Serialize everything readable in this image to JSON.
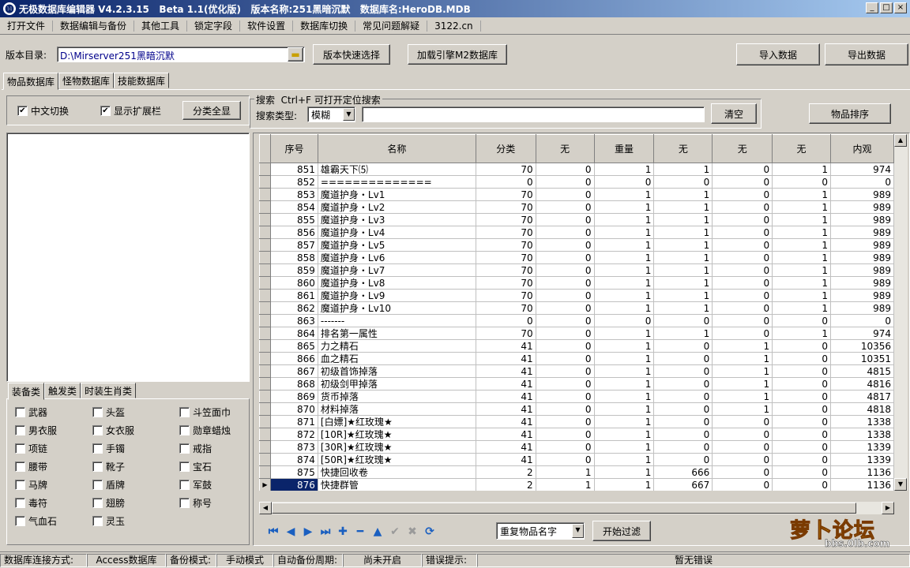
{
  "window": {
    "title": "无极数据库编辑器 V4.2.3.15   Beta 1.1(优化版)   版本名称:251黑暗沉默   数据库名:HeroDB.MDB",
    "min": "_",
    "max": "□",
    "close": "×"
  },
  "menu": [
    "打开文件",
    "数据编辑与备份",
    "其他工具",
    "锁定字段",
    "软件设置",
    "数据库切换",
    "常见问题解疑",
    "3122.cn"
  ],
  "toolbar": {
    "dir_label": "版本目录:",
    "dir_value": "D:\\Mirserver251黑暗沉默",
    "folder_icon": "folder-icon",
    "quick_select": "版本快速选择",
    "load_m2": "加载引擎M2数据库",
    "import": "导入数据",
    "export": "导出数据"
  },
  "tabs": [
    "物品数据库",
    "怪物数据库",
    "技能数据库"
  ],
  "left": {
    "cn_switch": "中文切换",
    "show_ext": "显示扩展栏",
    "show_all": "分类全显",
    "subtabs": [
      "装备类",
      "触发类",
      "时装生肖类"
    ],
    "categories": [
      [
        "武器",
        "头盔",
        "斗笠面巾"
      ],
      [
        "男衣服",
        "女衣服",
        "勋章蜡烛"
      ],
      [
        "项链",
        "手镯",
        "戒指"
      ],
      [
        "腰带",
        "靴子",
        "宝石"
      ],
      [
        "马牌",
        "盾牌",
        "军鼓"
      ],
      [
        "毒符",
        "翅膀",
        "称号"
      ],
      [
        "气血石",
        "灵玉",
        ""
      ]
    ]
  },
  "search": {
    "legend": "搜索  Ctrl+F 可打开定位搜索",
    "type_label": "搜索类型:",
    "type_value": "模糊",
    "input_value": "",
    "clear": "清空",
    "sort": "物品排序"
  },
  "grid": {
    "columns": [
      "序号",
      "名称",
      "分类",
      "无",
      "重量",
      "无",
      "无",
      "无",
      "内观"
    ],
    "rows": [
      [
        "851",
        "雄霸天下⑸",
        "70",
        "0",
        "1",
        "1",
        "0",
        "1",
        "974"
      ],
      [
        "852",
        "==============",
        "0",
        "0",
        "0",
        "0",
        "0",
        "0",
        "0"
      ],
      [
        "853",
        "魔道护身・Lv1",
        "70",
        "0",
        "1",
        "1",
        "0",
        "1",
        "989"
      ],
      [
        "854",
        "魔道护身・Lv2",
        "70",
        "0",
        "1",
        "1",
        "0",
        "1",
        "989"
      ],
      [
        "855",
        "魔道护身・Lv3",
        "70",
        "0",
        "1",
        "1",
        "0",
        "1",
        "989"
      ],
      [
        "856",
        "魔道护身・Lv4",
        "70",
        "0",
        "1",
        "1",
        "0",
        "1",
        "989"
      ],
      [
        "857",
        "魔道护身・Lv5",
        "70",
        "0",
        "1",
        "1",
        "0",
        "1",
        "989"
      ],
      [
        "858",
        "魔道护身・Lv6",
        "70",
        "0",
        "1",
        "1",
        "0",
        "1",
        "989"
      ],
      [
        "859",
        "魔道护身・Lv7",
        "70",
        "0",
        "1",
        "1",
        "0",
        "1",
        "989"
      ],
      [
        "860",
        "魔道护身・Lv8",
        "70",
        "0",
        "1",
        "1",
        "0",
        "1",
        "989"
      ],
      [
        "861",
        "魔道护身・Lv9",
        "70",
        "0",
        "1",
        "1",
        "0",
        "1",
        "989"
      ],
      [
        "862",
        "魔道护身・Lv10",
        "70",
        "0",
        "1",
        "1",
        "0",
        "1",
        "989"
      ],
      [
        "863",
        "-------",
        "0",
        "0",
        "0",
        "0",
        "0",
        "0",
        "0"
      ],
      [
        "864",
        "排名第一属性",
        "70",
        "0",
        "1",
        "1",
        "0",
        "1",
        "974"
      ],
      [
        "865",
        "力之精石",
        "41",
        "0",
        "1",
        "0",
        "1",
        "0",
        "10356"
      ],
      [
        "866",
        "血之精石",
        "41",
        "0",
        "1",
        "0",
        "1",
        "0",
        "10351"
      ],
      [
        "867",
        "初级首饰掉落",
        "41",
        "0",
        "1",
        "0",
        "1",
        "0",
        "4815"
      ],
      [
        "868",
        "初级剑甲掉落",
        "41",
        "0",
        "1",
        "0",
        "1",
        "0",
        "4816"
      ],
      [
        "869",
        "货币掉落",
        "41",
        "0",
        "1",
        "0",
        "1",
        "0",
        "4817"
      ],
      [
        "870",
        "材料掉落",
        "41",
        "0",
        "1",
        "0",
        "1",
        "0",
        "4818"
      ],
      [
        "871",
        "[白嫖]★红玫瑰★",
        "41",
        "0",
        "1",
        "0",
        "0",
        "0",
        "1338"
      ],
      [
        "872",
        "[10R]★红玫瑰★",
        "41",
        "0",
        "1",
        "0",
        "0",
        "0",
        "1338"
      ],
      [
        "873",
        "[30R]★红玫瑰★",
        "41",
        "0",
        "1",
        "0",
        "0",
        "0",
        "1339"
      ],
      [
        "874",
        "[50R]★红玫瑰★",
        "41",
        "0",
        "1",
        "0",
        "0",
        "0",
        "1339"
      ],
      [
        "875",
        "快捷回收卷",
        "2",
        "1",
        "1",
        "666",
        "0",
        "0",
        "1136"
      ],
      [
        "876",
        "快捷群管",
        "2",
        "1",
        "1",
        "667",
        "0",
        "0",
        "1136"
      ]
    ],
    "selected": 25
  },
  "nav": {
    "icons": [
      "first-icon",
      "prev-icon",
      "next-icon",
      "last-icon",
      "add-icon",
      "delete-icon",
      "up-icon",
      "confirm-icon",
      "cancel-icon",
      "refresh-icon"
    ],
    "glyphs": [
      "⏮",
      "◀",
      "▶",
      "⏭",
      "✚",
      "━",
      "▲",
      "✔",
      "✖",
      "⟳"
    ],
    "filter_value": "重复物品名字",
    "start_filter": "开始过滤"
  },
  "status": {
    "conn_label": "数据库连接方式:",
    "conn_value": "Access数据库",
    "backup_label": "备份模式:",
    "backup_value": "手动模式",
    "auto_label": "自动备份周期:",
    "auto_value": "尚未开启",
    "err_label": "错误提示:",
    "err_value": "暂无错误"
  },
  "watermark": {
    "text": "萝卜论坛",
    "url": "bbs.0lb.com"
  }
}
